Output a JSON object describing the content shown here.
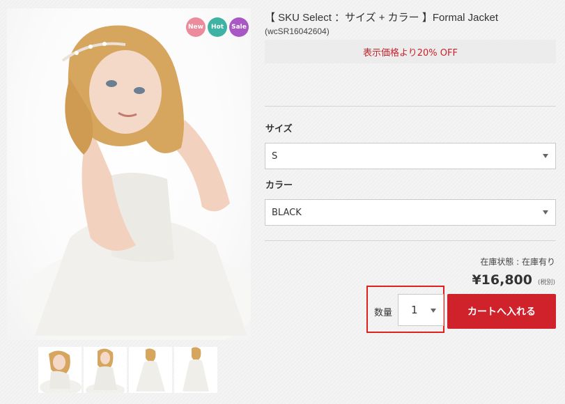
{
  "product": {
    "title": "【 SKU Select ：サイズ + カラー 】Formal Jacket",
    "sku": "(wcSR16042604)",
    "discount_text": "表示価格より20% OFF"
  },
  "badges": {
    "new": "New",
    "hot": "Hot",
    "sale": "Sale"
  },
  "size": {
    "label": "サイズ",
    "selected": "S"
  },
  "color": {
    "label": "カラー",
    "selected": "BLACK"
  },
  "stock": {
    "text": "在庫状態 : 在庫有り"
  },
  "price": {
    "amount": "¥16,800",
    "tax_note": "(税別)"
  },
  "quantity": {
    "label": "数量",
    "selected": "1"
  },
  "cart": {
    "button_label": "カートへ入れる"
  },
  "colors": {
    "accent_red": "#d0222b",
    "discount_text": "#c8222a",
    "highlight_border": "#e0201d"
  }
}
